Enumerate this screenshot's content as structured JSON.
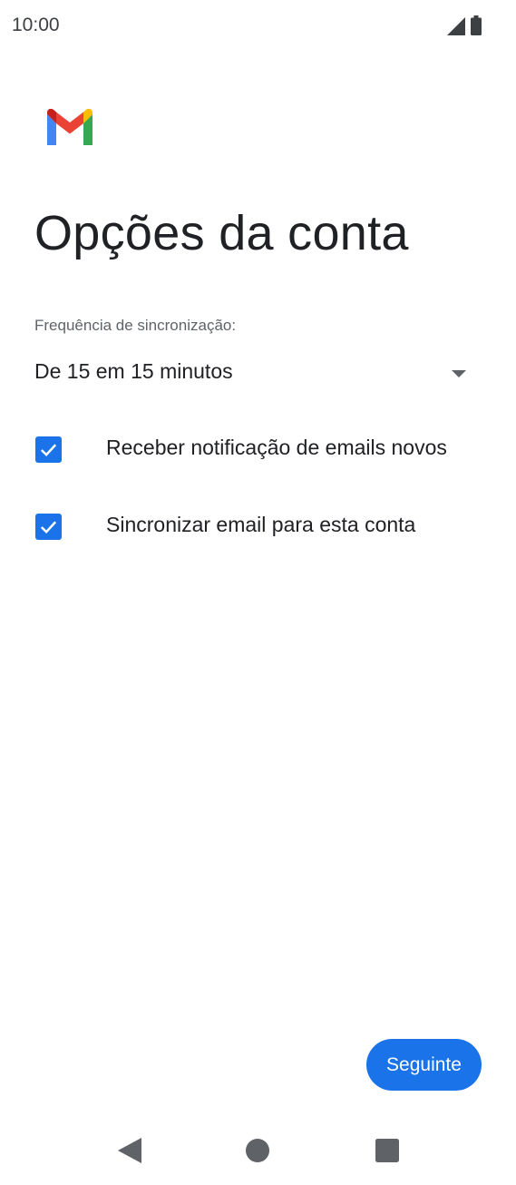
{
  "status_bar": {
    "time": "10:00",
    "icons": [
      "signal-icon",
      "battery-icon"
    ]
  },
  "app": {
    "logo": "gmail-logo-icon"
  },
  "page": {
    "title": "Opções da conta"
  },
  "sync": {
    "label": "Frequência de sincronização:",
    "selected": "De 15 em 15 minutos"
  },
  "options": [
    {
      "label": "Receber notificação de emails novos",
      "checked": true
    },
    {
      "label": "Sincronizar email para esta conta",
      "checked": true
    }
  ],
  "actions": {
    "next_label": "Seguinte"
  },
  "nav": {
    "items": [
      "back-icon",
      "home-icon",
      "recents-icon"
    ]
  },
  "colors": {
    "accent": "#1a73e8",
    "text_primary": "#202124",
    "text_secondary": "#5f6368"
  }
}
